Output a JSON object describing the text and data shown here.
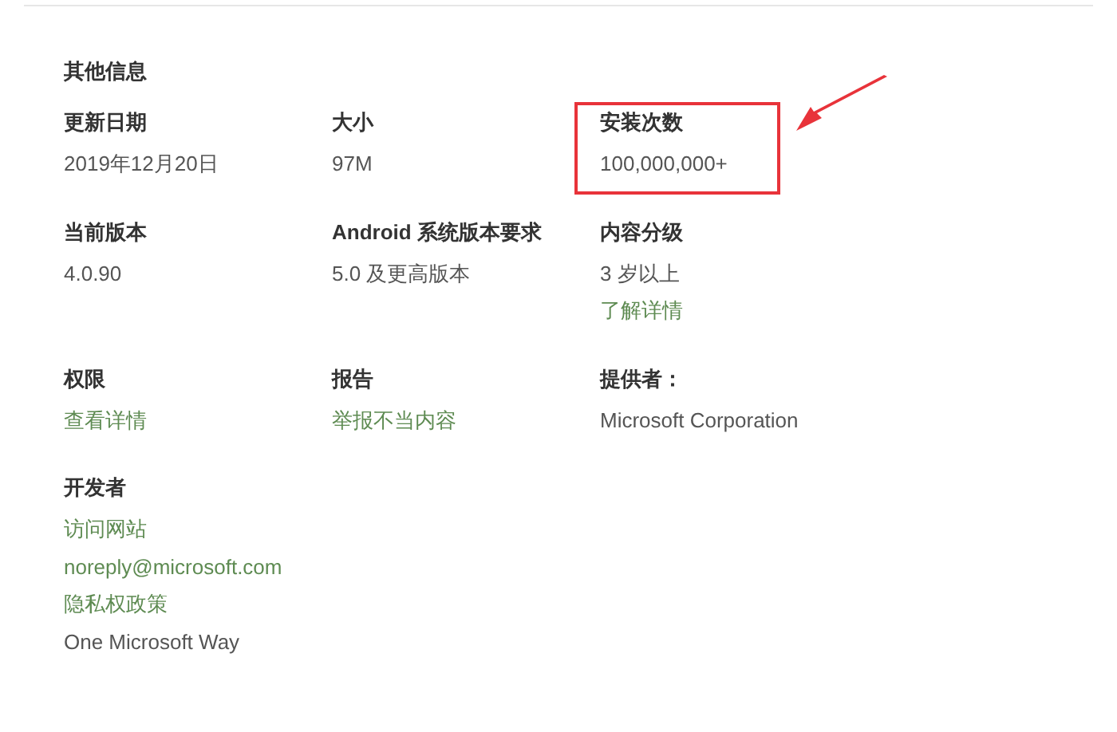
{
  "section_title": "其他信息",
  "items": [
    {
      "label": "更新日期",
      "highlighted": false,
      "lines": [
        {
          "kind": "text",
          "text": "2019年12月20日"
        }
      ]
    },
    {
      "label": "大小",
      "highlighted": false,
      "lines": [
        {
          "kind": "text",
          "text": "97M"
        }
      ]
    },
    {
      "label": "安装次数",
      "highlighted": true,
      "lines": [
        {
          "kind": "text",
          "text": "100,000,000+"
        }
      ]
    },
    {
      "label": "当前版本",
      "highlighted": false,
      "lines": [
        {
          "kind": "text",
          "text": "4.0.90"
        }
      ]
    },
    {
      "label": "Android 系统版本要求",
      "highlighted": false,
      "lines": [
        {
          "kind": "text",
          "text": "5.0 及更高版本"
        }
      ]
    },
    {
      "label": "内容分级",
      "highlighted": false,
      "lines": [
        {
          "kind": "text",
          "text": "3 岁以上"
        },
        {
          "kind": "link",
          "text": "了解详情"
        }
      ]
    },
    {
      "label": "权限",
      "highlighted": false,
      "lines": [
        {
          "kind": "link",
          "text": "查看详情"
        }
      ]
    },
    {
      "label": "报告",
      "highlighted": false,
      "lines": [
        {
          "kind": "link",
          "text": "举报不当内容"
        }
      ]
    },
    {
      "label": "提供者：",
      "highlighted": false,
      "lines": [
        {
          "kind": "text",
          "text": "Microsoft Corporation"
        }
      ]
    },
    {
      "label": "开发者",
      "highlighted": false,
      "lines": [
        {
          "kind": "link",
          "text": "访问网站"
        },
        {
          "kind": "link",
          "text": "noreply@microsoft.com"
        },
        {
          "kind": "link",
          "text": "隐私权政策"
        },
        {
          "kind": "text",
          "text": "One Microsoft Way"
        }
      ]
    }
  ]
}
